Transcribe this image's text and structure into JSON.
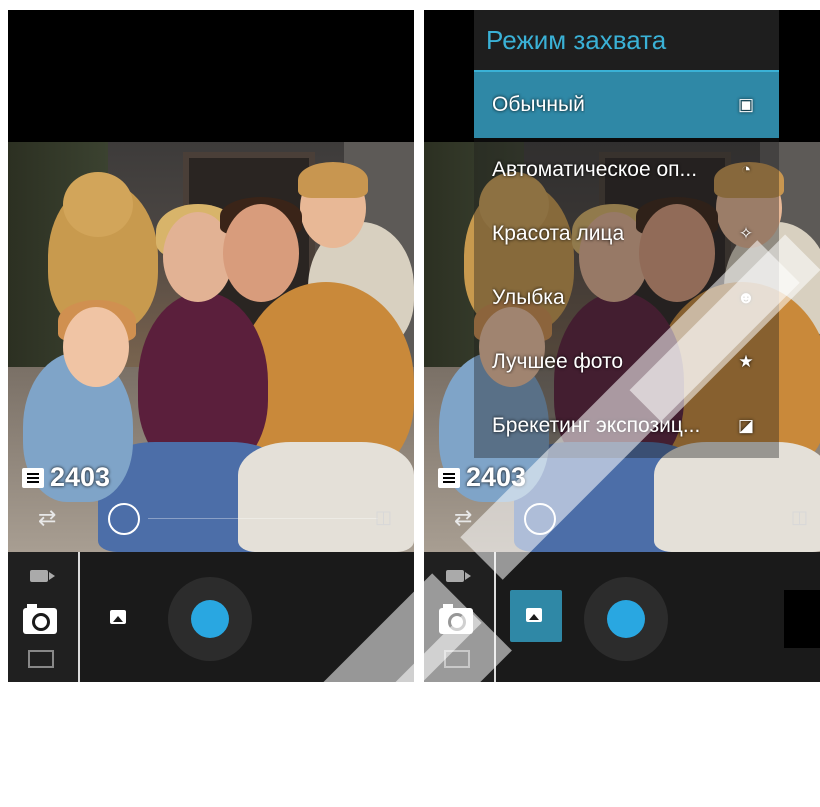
{
  "left_screen": {
    "counter": "2403",
    "icons": {
      "counter": "memory-card-icon",
      "switch": "switch-camera-icon",
      "focus": "focus-ring-icon",
      "flip": "flip-icon",
      "video": "video-camera-icon",
      "camera": "photo-camera-icon",
      "panorama": "panorama-icon",
      "gallery": "gallery-icon",
      "shutter": "shutter-button"
    }
  },
  "right_screen": {
    "counter": "2403",
    "capture_menu": {
      "title": "Режим захвата",
      "items": [
        {
          "label": "Обычный",
          "icon": "picture-icon",
          "glyph": "▣",
          "selected": true
        },
        {
          "label": "Автоматическое оп...",
          "icon": "scene-detect-icon",
          "glyph": "◔",
          "selected": false
        },
        {
          "label": "Красота лица",
          "icon": "face-beauty-icon",
          "glyph": "✧",
          "selected": false
        },
        {
          "label": "Улыбка",
          "icon": "smile-icon",
          "glyph": "☻",
          "selected": false
        },
        {
          "label": "Лучшее фото",
          "icon": "star-icon",
          "glyph": "★",
          "selected": false
        },
        {
          "label": "Брекетинг экспозиц...",
          "icon": "exposure-icon",
          "glyph": "◪",
          "selected": false
        }
      ]
    }
  },
  "colors": {
    "accent": "#2f88a6",
    "menu_title": "#3ab1d6",
    "shutter": "#29a7e1"
  }
}
